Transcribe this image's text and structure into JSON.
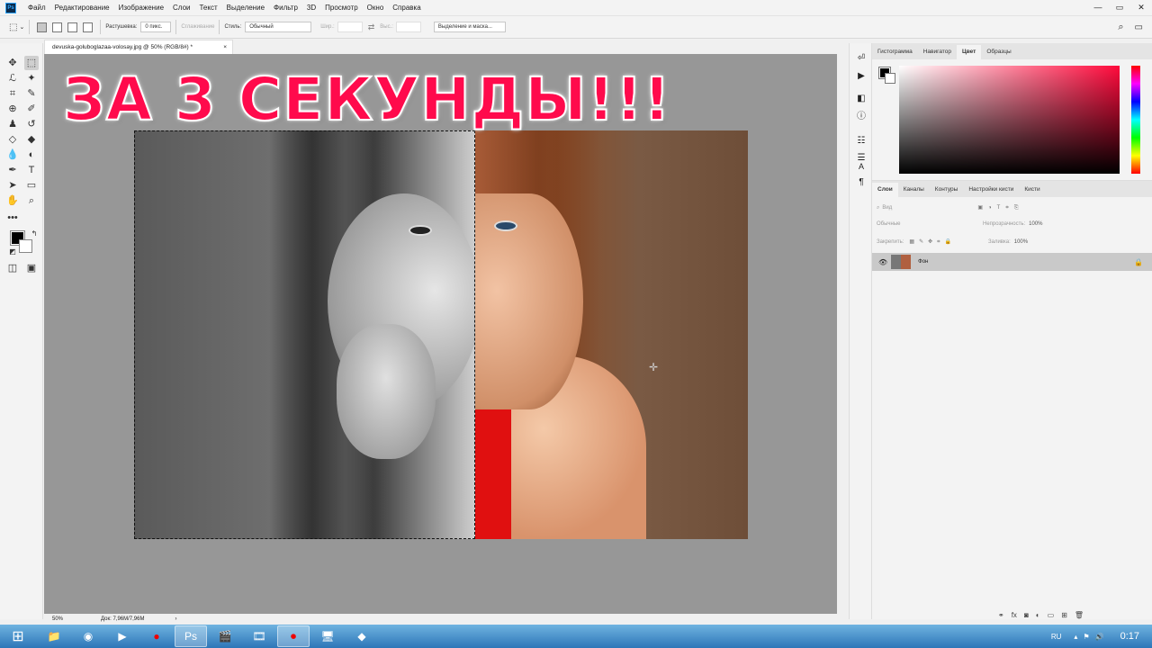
{
  "menubar": {
    "items": [
      "Файл",
      "Редактирование",
      "Изображение",
      "Слои",
      "Текст",
      "Выделение",
      "Фильтр",
      "3D",
      "Просмотр",
      "Окно",
      "Справка"
    ],
    "window_buttons": [
      "—",
      "▭",
      "✕"
    ]
  },
  "options": {
    "feather_label": "Растушевка:",
    "feather_value": "0 пикс.",
    "antialias_label": "Сглаживание",
    "style_label": "Стиль:",
    "style_value": "Обычный",
    "width_label": "Шир.:",
    "height_label": "Выс.:",
    "select_mask_label": "Выделение и маска..."
  },
  "document": {
    "tab_title": "devuska-goluboglazaa-volosay.jpg @ 50% (RGB/8#) *",
    "tab_close": "×",
    "overlay_text": "ЗА 3 СЕКУНДЫ!!!"
  },
  "statusbar": {
    "zoom": "50%",
    "doc_info": "Док: 7,96M/7,96M"
  },
  "color_panel": {
    "tabs": [
      "Гистограмма",
      "Навигатор",
      "Цвет",
      "Образцы"
    ],
    "active_tab": "Цвет"
  },
  "layers_panel": {
    "tabs": [
      "Слои",
      "Каналы",
      "Контуры",
      "Настройки кисти",
      "Кисти"
    ],
    "active_tab": "Слои",
    "filter_placeholder": "Вид",
    "blend_mode": "Обычные",
    "opacity_label": "Непрозрачность:",
    "opacity_value": "100%",
    "lock_label": "Закрепить:",
    "fill_label": "Заливка:",
    "fill_value": "100%",
    "layer_name": "Фон"
  },
  "taskbar": {
    "lang": "RU",
    "clock": "0:17"
  }
}
